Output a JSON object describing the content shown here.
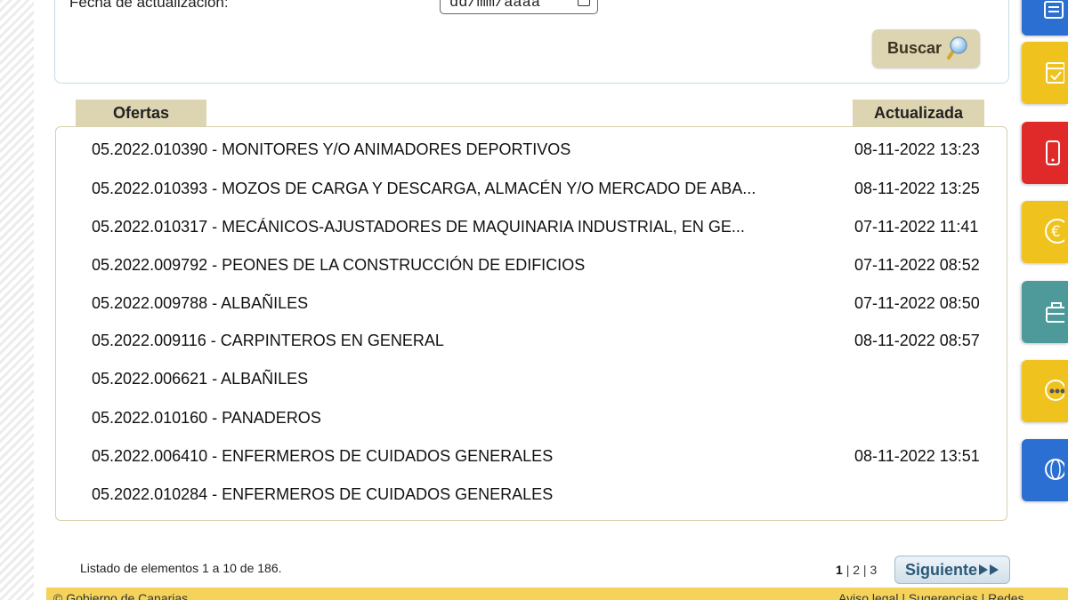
{
  "search": {
    "date_label": "Fecha de actualización:",
    "date_placeholder": "dd/mm/aaaa",
    "button_label": "Buscar"
  },
  "table": {
    "headers": {
      "offers": "Ofertas",
      "updated": "Actualizada"
    },
    "rows": [
      {
        "title": "05.2022.010390 - MONITORES Y/O ANIMADORES DEPORTIVOS",
        "date": "08-11-2022 13:23"
      },
      {
        "title": "05.2022.010393 - MOZOS DE CARGA Y DESCARGA, ALMACÉN Y/O MERCADO DE ABA...",
        "date": "08-11-2022 13:25"
      },
      {
        "title": "05.2022.010317 - MECÁNICOS-AJUSTADORES DE MAQUINARIA INDUSTRIAL, EN GE...",
        "date": "07-11-2022 11:41"
      },
      {
        "title": "05.2022.009792 - PEONES DE LA CONSTRUCCIÓN DE EDIFICIOS",
        "date": "07-11-2022 08:52"
      },
      {
        "title": "05.2022.009788 - ALBAÑILES",
        "date": "07-11-2022 08:50"
      },
      {
        "title": "05.2022.009116 - CARPINTEROS EN GENERAL",
        "date": "08-11-2022 08:57"
      },
      {
        "title": "05.2022.006621 - ALBAÑILES",
        "date": ""
      },
      {
        "title": "05.2022.010160 - PANADEROS",
        "date": ""
      },
      {
        "title": "05.2022.006410 - ENFERMEROS DE CUIDADOS GENERALES",
        "date": "08-11-2022 13:51"
      },
      {
        "title": "05.2022.010284 - ENFERMEROS DE CUIDADOS GENERALES",
        "date": ""
      }
    ]
  },
  "pagination": {
    "listing_text": "Listado de elementos 1 a 10 de 186.",
    "pages": [
      "1",
      "2",
      "3"
    ],
    "separator": "|",
    "current_page": "1",
    "next_label": "Siguiente"
  },
  "footer": {
    "left_text": "© Gobierno de Canarias",
    "right_text": "Aviso legal | Sugerencias | Redes"
  },
  "side_icons": [
    {
      "icon": "document-icon",
      "color": "#2a6fd1"
    },
    {
      "icon": "calendar-icon",
      "color": "#f0c21e"
    },
    {
      "icon": "mobile-icon",
      "color": "#e02a2a"
    },
    {
      "icon": "euro-icon",
      "color": "#f0c21e"
    },
    {
      "icon": "briefcase-icon",
      "color": "#4e9a9a"
    },
    {
      "icon": "group-icon",
      "color": "#f0c21e"
    },
    {
      "icon": "globe-icon",
      "color": "#2a6fd1"
    }
  ]
}
